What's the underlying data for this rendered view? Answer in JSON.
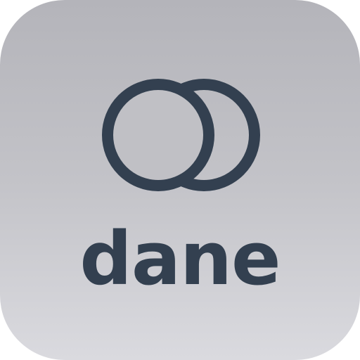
{
  "app": {
    "name": "dane"
  },
  "logo": {
    "icon": "overlapping-circles-icon",
    "color": "#334050"
  },
  "tile": {
    "gradient_top": "#b4b4ba",
    "gradient_bottom": "#dadadf"
  }
}
